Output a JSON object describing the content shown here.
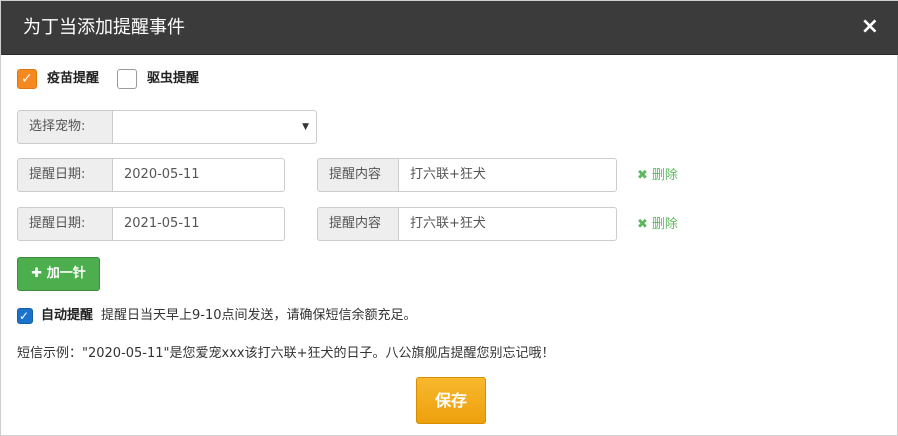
{
  "dialog": {
    "title": "为丁当添加提醒事件",
    "close_label": "×"
  },
  "checkboxes": {
    "vaccine": {
      "label": "疫苗提醒",
      "checked": true
    },
    "deworm": {
      "label": "驱虫提醒",
      "checked": false
    }
  },
  "pet_select": {
    "label": "选择宠物:",
    "value": ""
  },
  "reminders": [
    {
      "date_label": "提醒日期:",
      "date": "2020-05-11",
      "content_label": "提醒内容",
      "content": "打六联+狂犬",
      "delete_label": "删除"
    },
    {
      "date_label": "提醒日期:",
      "date": "2021-05-11",
      "content_label": "提醒内容",
      "content": "打六联+狂犬",
      "delete_label": "删除"
    }
  ],
  "add_button": {
    "label": "加一针"
  },
  "auto_remind": {
    "checked": true,
    "label": "自动提醒",
    "description": "提醒日当天早上9-10点间发送，请确保短信余额充足。"
  },
  "sms_example": "短信示例：\"2020-05-11\"是您爱宠xxx该打六联+狂犬的日子。八公旗舰店提醒您别忘记哦！",
  "save_button": {
    "label": "保存"
  },
  "colors": {
    "header_bg": "#3b3b3b",
    "accent_orange": "#f5891f",
    "success_green": "#4cae4c",
    "save_gold": "#f0a30f",
    "checkbox_blue": "#1a73c9"
  }
}
